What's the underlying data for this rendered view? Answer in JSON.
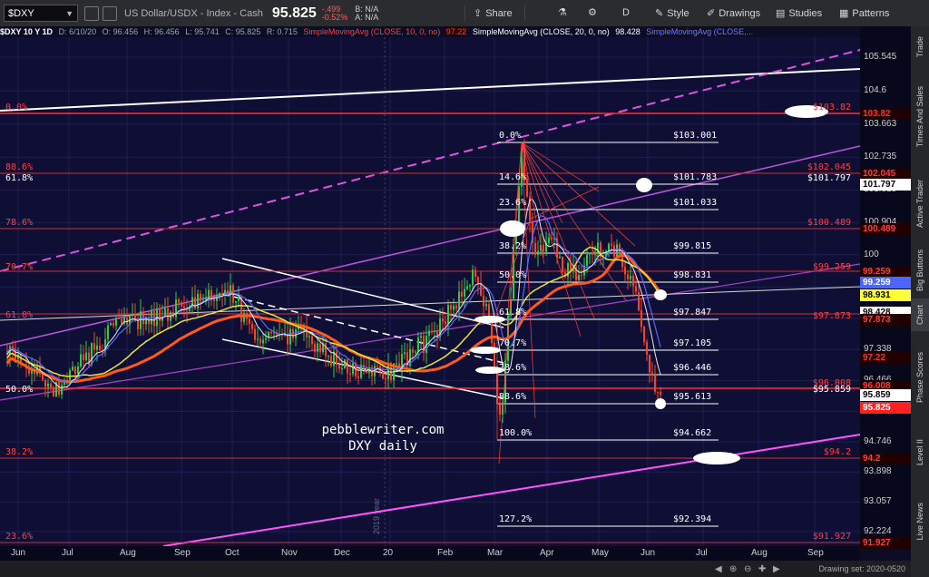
{
  "toolbar": {
    "symbol": "$DXY",
    "description": "US Dollar/USDX - Index - Cash",
    "last": "95.825",
    "change": "-.499",
    "change_pct": "-0.52%",
    "bid": "B: N/A",
    "ask": "A: N/A",
    "share": "Share",
    "period": "D",
    "style": "Style",
    "drawings": "Drawings",
    "studies": "Studies",
    "patterns": "Patterns"
  },
  "legend": {
    "header": "$DXY 10 Y 1D",
    "date": "D: 6/10/20",
    "open": "O: 96.456",
    "high": "H: 96.456",
    "low": "L: 95.741",
    "close": "C: 95.825",
    "range": "R: 0.715",
    "sma10": "SimpleMovingAvg (CLOSE, 10, 0, no)",
    "sma10_val": "97.22",
    "sma20": "SimpleMovingAvg (CLOSE, 20, 0, no)",
    "sma20_val": "98.428",
    "sma_other": "SimpleMovingAvg (CLOSE,..."
  },
  "price_axis": {
    "ticks": [
      "105.545",
      "104.6",
      "103.663",
      "102.735",
      "101.815",
      "100.904",
      "100",
      "99.092",
      "98.217",
      "97.338",
      "96.466",
      "95.602",
      "94.746",
      "93.898",
      "93.057",
      "92.224"
    ],
    "tags": [
      {
        "text": "103.82",
        "color": "#ff3030"
      },
      {
        "text": "102.045",
        "color": "#ff4040"
      },
      {
        "text": "101.797",
        "color": "#ffffff"
      },
      {
        "text": "100.489",
        "color": "#ff4040"
      },
      {
        "text": "99.259",
        "color": "#ff4040"
      },
      {
        "text": "99.259",
        "color": "#4a66ff"
      },
      {
        "text": "98.931",
        "color": "#ffff33"
      },
      {
        "text": "98.428",
        "color": "#ffffff"
      },
      {
        "text": "97.873",
        "color": "#ff4040"
      },
      {
        "text": "97.22",
        "color": "#ff3030"
      },
      {
        "text": "96.008",
        "color": "#ff4040"
      },
      {
        "text": "95.859",
        "color": "#ffffff"
      },
      {
        "text": "95.825",
        "color": "#ff2020"
      },
      {
        "text": "94.2",
        "color": "#ff4040"
      },
      {
        "text": "91.927",
        "color": "#ff4040"
      }
    ]
  },
  "fib_right": [
    {
      "pct": "0.0%",
      "value": "$103.001"
    },
    {
      "pct": "14.6%",
      "value": "$101.783"
    },
    {
      "pct": "23.6%",
      "value": "$101.033"
    },
    {
      "pct": "38.2%",
      "value": "$99.815"
    },
    {
      "pct": "50.0%",
      "value": "$98.831"
    },
    {
      "pct": "61.8%",
      "value": "$97.847"
    },
    {
      "pct": "70.7%",
      "value": "$97.105"
    },
    {
      "pct": "78.6%",
      "value": "$96.446"
    },
    {
      "pct": "88.6%",
      "value": "$95.613"
    },
    {
      "pct": "100.0%",
      "value": "$94.662"
    },
    {
      "pct": "127.2%",
      "value": "$92.394"
    }
  ],
  "fib_left": [
    {
      "pct": "0.0%",
      "color": "#ff4040"
    },
    {
      "pct": "88.6%",
      "color": "#ff4040"
    },
    {
      "pct": "61.8%",
      "color": "#ffffff"
    },
    {
      "pct": "78.6%",
      "color": "#ff4040"
    },
    {
      "pct": "70.7%",
      "color": "#ff4040"
    },
    {
      "pct": "61.8%",
      "color": "#ff4040"
    },
    {
      "pct": "50.0%",
      "color": "#ffffff"
    },
    {
      "pct": "38.2%",
      "color": "#ff4040"
    },
    {
      "pct": "23.6%",
      "color": "#ff4040"
    }
  ],
  "fib_right_labels": {
    "l1": "$102.045",
    "l2": "$101.797",
    "l3": "$100.489",
    "l4": "$99.259",
    "l5": "$97.873",
    "l6": "$96.008",
    "l7": "$95.859",
    "l8": "$94.2",
    "l9": "$91.927",
    "l10": "$103.82"
  },
  "watermark": {
    "line1": "pebblewriter.com",
    "line2": "DXY daily"
  },
  "year_marker": "2019 year",
  "date_axis": [
    "Jun",
    "Jul",
    "Aug",
    "Sep",
    "Oct",
    "Nov",
    "Dec",
    "20",
    "Feb",
    "Mar",
    "Apr",
    "May",
    "Jun",
    "Jul",
    "Aug",
    "Sep"
  ],
  "drawing_set": "Drawing set: 2020-0520",
  "siderail": [
    "Trade",
    "Times And Sales",
    "Active Trader",
    "Big Buttons",
    "Chart",
    "Phase Scores",
    "Level II",
    "Live News"
  ],
  "colors": {
    "background": "#0f0f36",
    "bull": "#2ecc40",
    "bear": "#ff4020",
    "fib": "#ff3030",
    "accent": "#ff44ff"
  }
}
